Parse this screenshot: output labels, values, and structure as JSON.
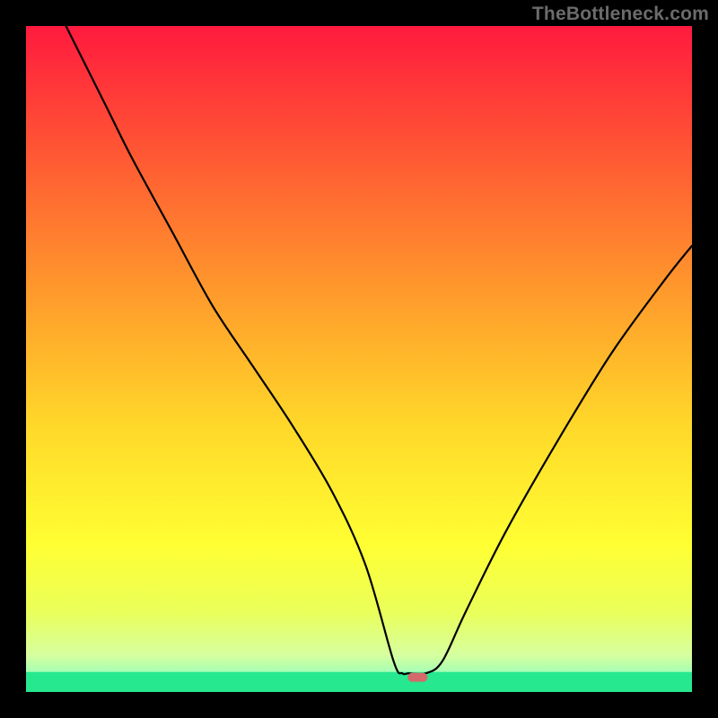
{
  "attribution": "TheBottleneck.com",
  "chart_data": {
    "type": "line",
    "title": "",
    "xlabel": "",
    "ylabel": "",
    "xlim": [
      0,
      100
    ],
    "ylim": [
      0,
      100
    ],
    "gradient_stops": [
      {
        "offset": 0,
        "color": "#ff1a3e"
      },
      {
        "offset": 0.2,
        "color": "#ff5a33"
      },
      {
        "offset": 0.4,
        "color": "#ff9a2c"
      },
      {
        "offset": 0.6,
        "color": "#ffd829"
      },
      {
        "offset": 0.78,
        "color": "#ffff33"
      },
      {
        "offset": 0.88,
        "color": "#eaff5a"
      },
      {
        "offset": 0.945,
        "color": "#d6ffa0"
      },
      {
        "offset": 0.975,
        "color": "#9cffb8"
      },
      {
        "offset": 1.0,
        "color": "#26ff9e"
      }
    ],
    "series": [
      {
        "name": "bottleneck-curve",
        "x": [
          6,
          12,
          16,
          22,
          28,
          34,
          40,
          46,
          51,
          55.2,
          56.5,
          57.5,
          60,
          62.5,
          66,
          72,
          80,
          88,
          96,
          100
        ],
        "y": [
          100,
          88,
          80,
          69,
          58,
          49,
          40,
          30,
          19,
          4.6,
          2.8,
          2.8,
          2.8,
          4.6,
          12,
          24,
          38,
          51,
          62,
          67
        ]
      }
    ],
    "marker": {
      "name": "optimal-point",
      "x": 58.8,
      "y": 2.2,
      "color": "#d46a6a"
    },
    "green_band_top_y": 3.0
  }
}
